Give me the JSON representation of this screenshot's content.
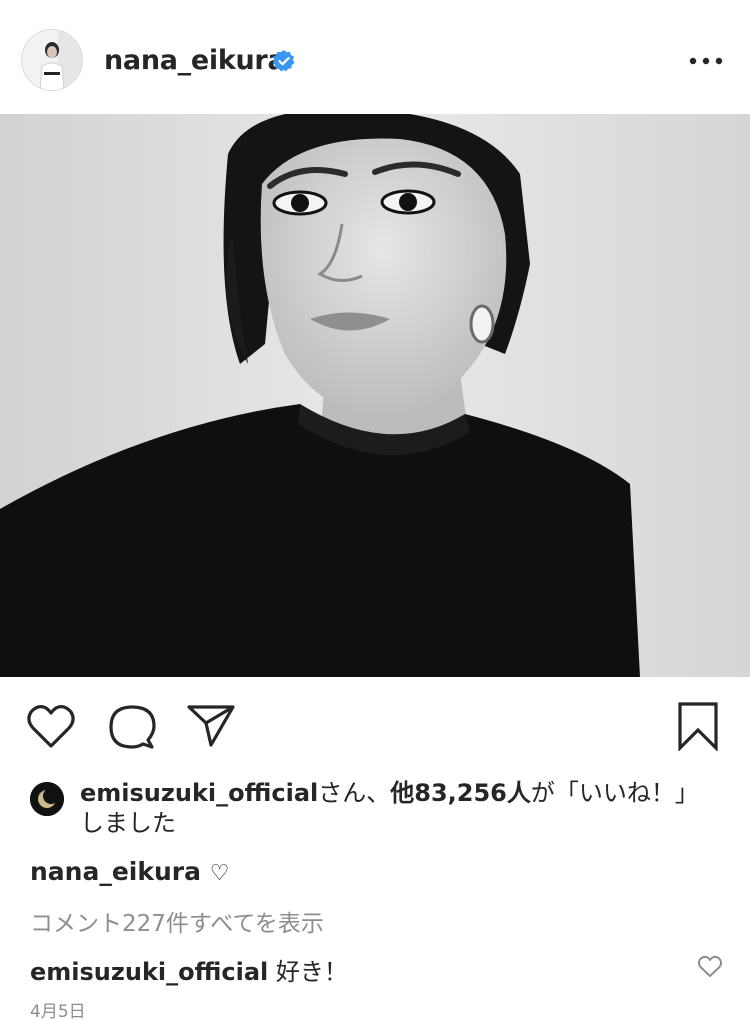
{
  "post": {
    "username": "nana_eikura",
    "verified": true,
    "more_icon": "more-horizontal-icon",
    "photo_alt": "",
    "likes": {
      "user": "emisuzuki_official",
      "text_mid": "さん、",
      "count_text": "他83,256人",
      "text_tail": "が「いいね！」しました"
    },
    "caption": {
      "username": "nana_eikura",
      "text": "♡"
    },
    "view_all_comments": "コメント227件すべてを表示",
    "comments": [
      {
        "username": "emisuzuki_official",
        "text": " 好き！"
      }
    ],
    "date": "4月5日"
  },
  "colors": {
    "text": "#262626",
    "muted": "#8e8e8e",
    "verified_blue": "#3897f0",
    "background": "#ffffff"
  }
}
